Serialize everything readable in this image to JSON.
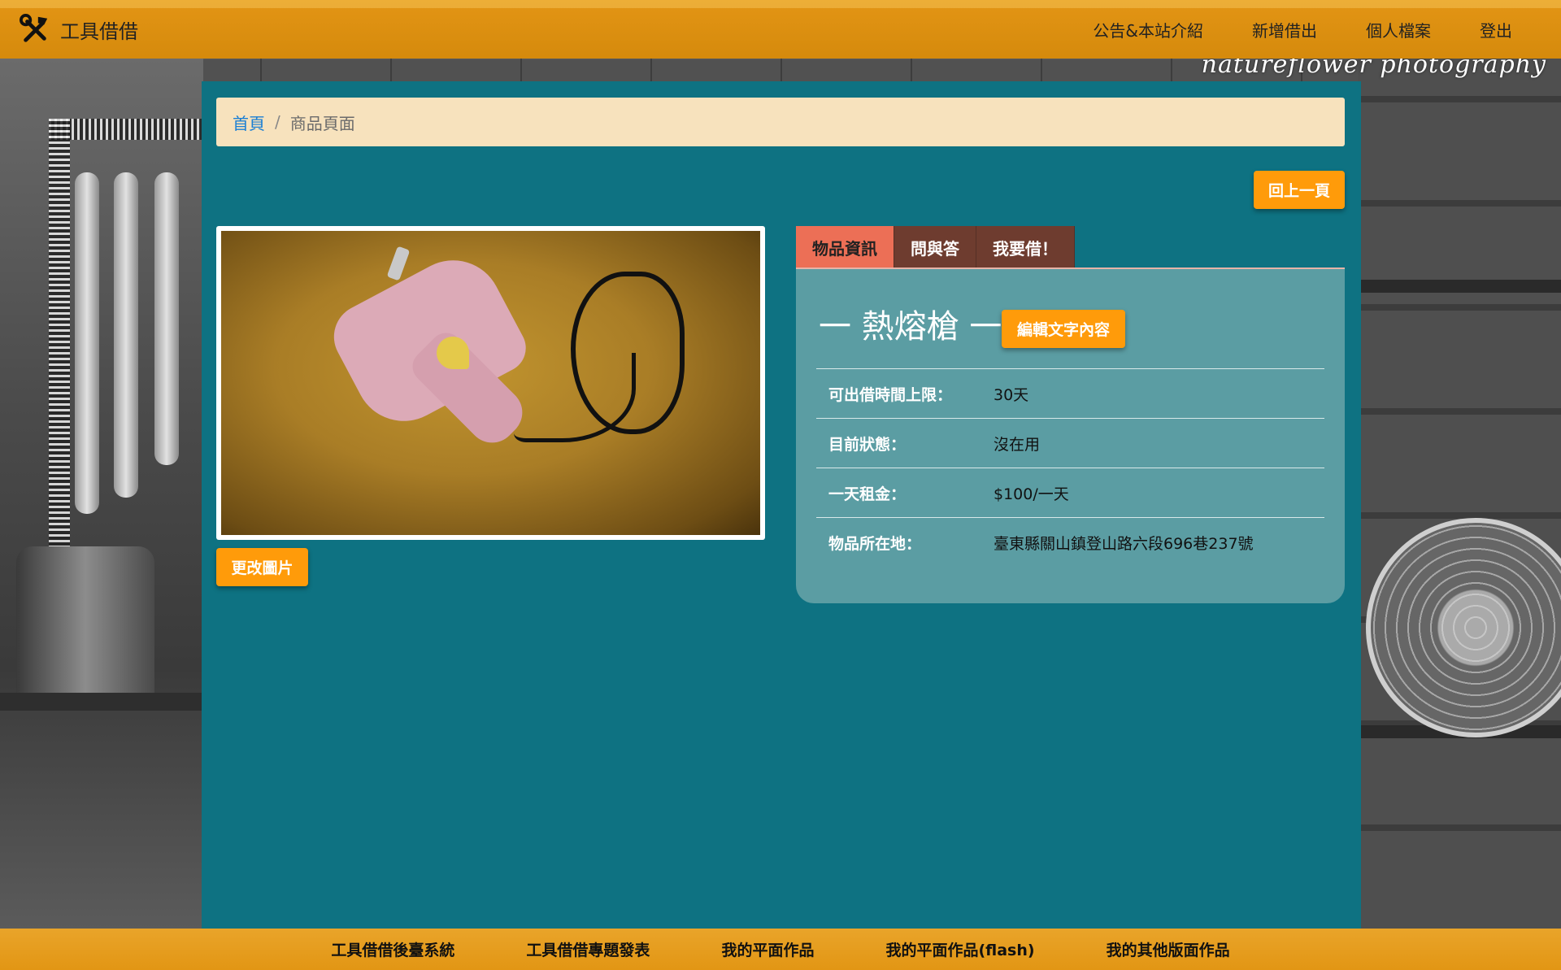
{
  "app": {
    "brand": "工具借借",
    "watermark": "natureflower photography"
  },
  "nav": {
    "items": [
      "公告&本站介紹",
      "新增借出",
      "個人檔案",
      "登出"
    ]
  },
  "breadcrumb": {
    "home": "首頁",
    "separator": "/",
    "current": "商品頁面"
  },
  "actions": {
    "back": "回上一頁",
    "change_image": "更改圖片",
    "edit_text": "編輯文字內容"
  },
  "tabs": [
    {
      "label": "物品資訊",
      "active": true
    },
    {
      "label": "問與答",
      "active": false
    },
    {
      "label": "我要借！",
      "active": false
    }
  ],
  "item": {
    "title": "一 熱熔槍 一",
    "details": [
      {
        "label": "可出借時間上限：",
        "value": "30天"
      },
      {
        "label": "目前狀態：",
        "value": "沒在用"
      },
      {
        "label": "一天租金：",
        "value": "$100/一天"
      },
      {
        "label": "物品所在地：",
        "value": "臺東縣關山鎮登山路六段696巷237號"
      }
    ]
  },
  "footer": {
    "links": [
      "工具借借後臺系統",
      "工具借借專題發表",
      "我的平面作品",
      "我的平面作品(flash)",
      "我的其他版面作品"
    ]
  },
  "colors": {
    "navbar": "#d58a0c",
    "panel": "#0e7282",
    "breadcrumb_bg": "#f7e2bd",
    "button": "#ff9b0a",
    "tab_active": "#ec6f56",
    "tab_inactive": "#6e3c2f",
    "info_card": "#5b9da3",
    "footer": "#e29614"
  }
}
